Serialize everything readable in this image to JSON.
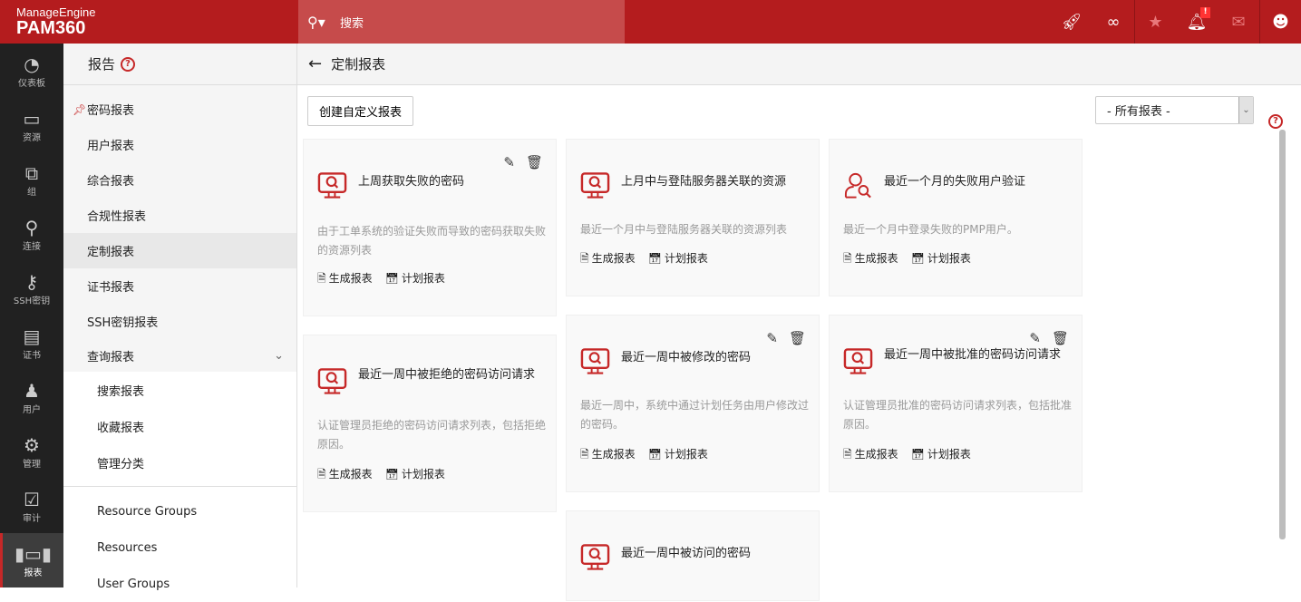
{
  "header": {
    "brand": "ManageEngine",
    "product": "PAM360",
    "search_placeholder": "搜索",
    "notification_badge": "!"
  },
  "left_nav": [
    {
      "label": "仪表板",
      "icon": "dashboard-icon"
    },
    {
      "label": "资源",
      "icon": "monitor-icon"
    },
    {
      "label": "组",
      "icon": "group-icon"
    },
    {
      "label": "连接",
      "icon": "connection-icon"
    },
    {
      "label": "SSH密钥",
      "icon": "ssh-key-icon"
    },
    {
      "label": "证书",
      "icon": "certificate-icon"
    },
    {
      "label": "用户",
      "icon": "user-icon"
    },
    {
      "label": "管理",
      "icon": "gear-icon"
    },
    {
      "label": "审计",
      "icon": "audit-icon"
    },
    {
      "label": "报表",
      "icon": "chart-icon"
    }
  ],
  "side": {
    "title": "报告",
    "items": [
      "密码报表",
      "用户报表",
      "综合报表",
      "合规性报表",
      "定制报表",
      "证书报表",
      "SSH密钥报表",
      "查询报表"
    ],
    "sub_items": [
      "搜索报表",
      "收藏报表",
      "管理分类"
    ],
    "extra_items": [
      "Resource Groups",
      "Resources",
      "User Groups"
    ]
  },
  "main": {
    "title": "定制报表",
    "create_button": "创建自定义报表",
    "filter_value": "- 所有报表 -",
    "generate_label": "生成报表",
    "schedule_label": "计划报表",
    "cards": [
      {
        "title": "上周获取失败的密码",
        "desc": "由于工单系统的验证失败而导致的密码获取失败的资源列表",
        "icon": "monitor-search"
      },
      {
        "title": "上月中与登陆服务器关联的资源",
        "desc": "最近一个月中与登陆服务器关联的资源列表",
        "icon": "monitor-search"
      },
      {
        "title": "最近一个月的失败用户验证",
        "desc": "最近一个月中登录失败的PMP用户。",
        "icon": "user-search"
      },
      {
        "title": "最近一周中被拒绝的密码访问请求",
        "desc": "认证管理员拒绝的密码访问请求列表，包括拒绝原因。",
        "icon": "monitor-search"
      },
      {
        "title": "最近一周中被修改的密码",
        "desc": "最近一周中，系统中通过计划任务由用户修改过的密码。",
        "icon": "monitor-search"
      },
      {
        "title": "最近一周中被批准的密码访问请求",
        "desc": "认证管理员批准的密码访问请求列表，包括批准原因。",
        "icon": "monitor-search"
      },
      {
        "title": "最近一周中被访问的密码",
        "desc": "",
        "icon": "monitor-search"
      }
    ]
  }
}
